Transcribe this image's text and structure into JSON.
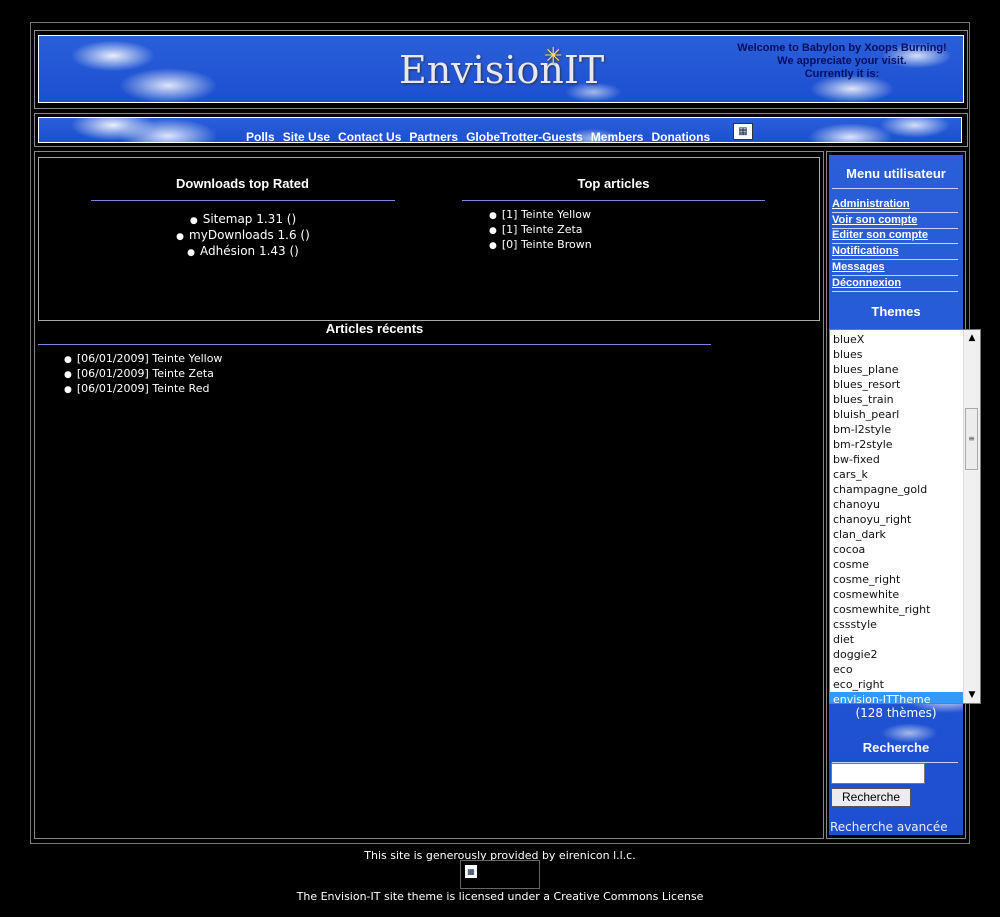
{
  "header": {
    "logo_text": "Envision",
    "logo_suffix": "IT",
    "welcome_line1": "Welcome to Babylon by Xoops Burning!",
    "welcome_line2": "We appreciate your visit.",
    "welcome_line3": "Currently it is:"
  },
  "nav": {
    "items": [
      "Polls",
      "Site Use",
      "Contact Us",
      "Partners",
      "GlobeTrotter-Guests",
      "Members",
      "Donations"
    ]
  },
  "downloads": {
    "title": "Downloads top Rated",
    "items": [
      "Sitemap 1.31 ()",
      "myDownloads 1.6 ()",
      "Adhésion 1.43 ()"
    ]
  },
  "top_articles": {
    "title": "Top articles",
    "items": [
      "[1] Teinte Yellow",
      "[1] Teinte Zeta",
      "[0] Teinte Brown"
    ]
  },
  "recent_articles": {
    "title": "Articles récents",
    "items": [
      "[06/01/2009] Teinte Yellow",
      "[06/01/2009] Teinte Zeta",
      "[06/01/2009] Teinte Red"
    ]
  },
  "user_menu": {
    "title": "Menu utilisateur",
    "items": [
      "Administration",
      "Voir son compte",
      "Editer son compte",
      "Notifications",
      "Messages",
      "Déconnexion"
    ]
  },
  "themes": {
    "title": "Themes",
    "options": [
      "blueX",
      "blues",
      "blues_plane",
      "blues_resort",
      "blues_train",
      "bluish_pearl",
      "bm-l2style",
      "bm-r2style",
      "bw-fixed",
      "cars_k",
      "champagne_gold",
      "chanoyu",
      "chanoyu_right",
      "clan_dark",
      "cocoa",
      "cosme",
      "cosme_right",
      "cosmewhite",
      "cosmewhite_right",
      "cssstyle",
      "diet",
      "doggie2",
      "eco",
      "eco_right",
      "envision-ITTheme"
    ],
    "selected": "envision-ITTheme",
    "count_text": "(128 thèmes)"
  },
  "search": {
    "title": "Recherche",
    "input_value": "",
    "button_label": "Recherche",
    "advanced_label": "Recherche avancée"
  },
  "footer": {
    "provided_by": "This site is generously provided by eirenicon l.l.c.",
    "license": "The Envision-IT site theme is licensed under a Creative Commons License"
  },
  "colors": {
    "page_bg": "#000000",
    "sky_blue": "#1d4fd0",
    "rule_blue": "#7f86d8",
    "selected_option": "#3399ff"
  }
}
